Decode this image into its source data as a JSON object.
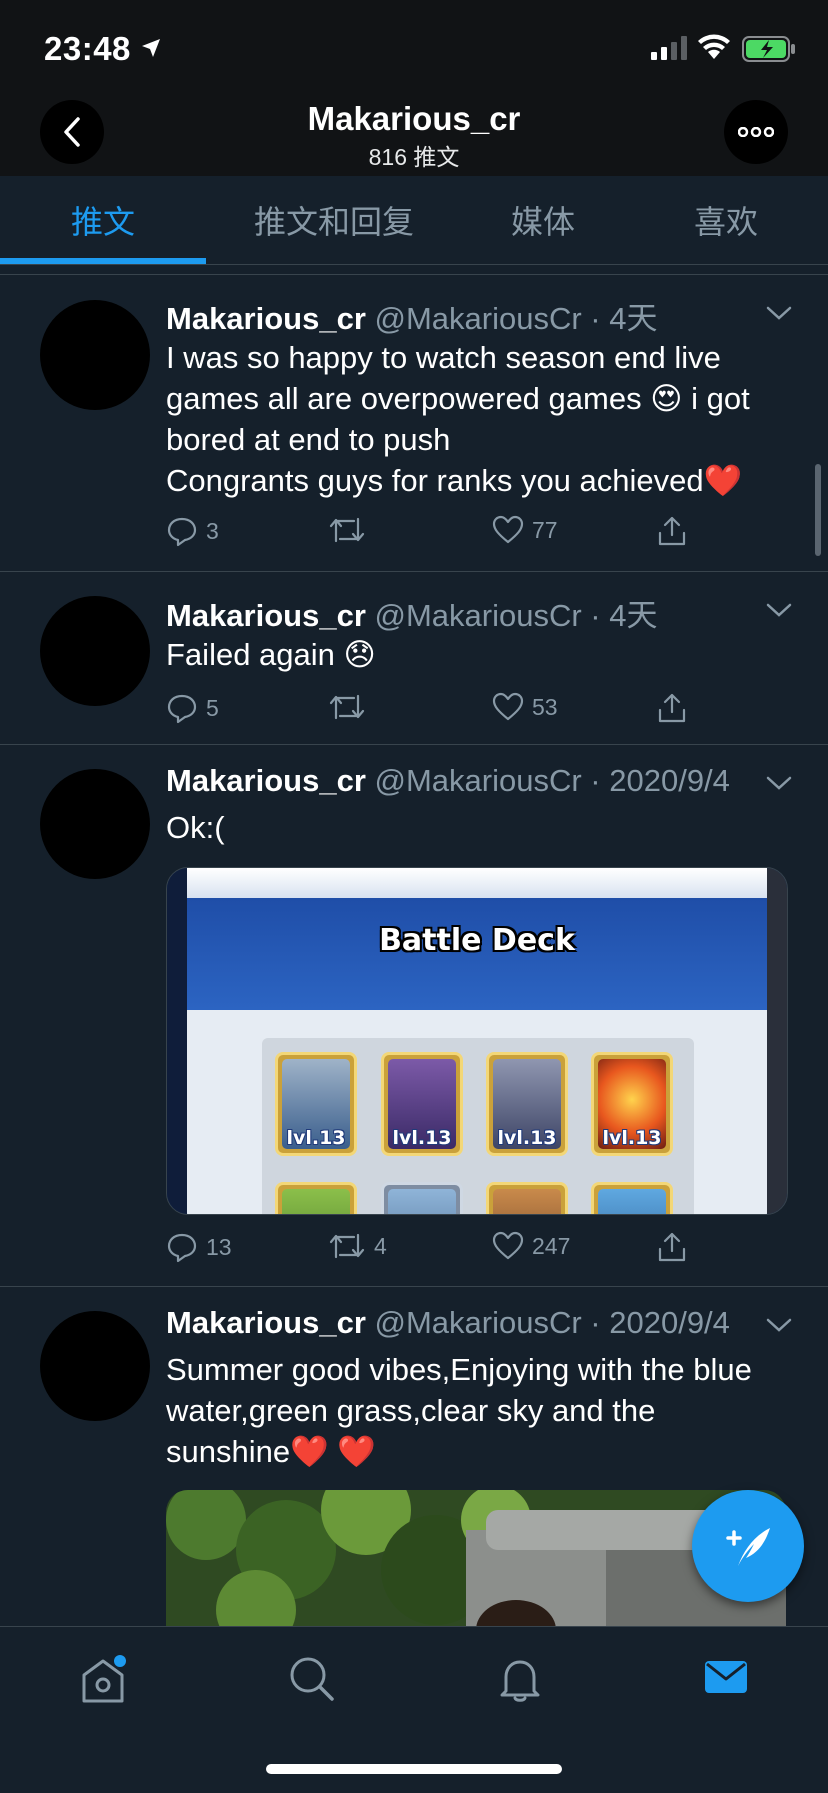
{
  "status_bar": {
    "time": "23:48",
    "icons": [
      "location-arrow-icon",
      "cellular-signal-icon",
      "wifi-icon",
      "battery-charging-icon"
    ]
  },
  "header": {
    "title": "Makarious_cr",
    "subtitle": "816 推文",
    "back_icon": "chevron-left-icon",
    "more_icon": "more-dots-icon"
  },
  "tabs": [
    {
      "label": "推文",
      "active": true
    },
    {
      "label": "推文和回复",
      "active": false
    },
    {
      "label": "媒体",
      "active": false
    },
    {
      "label": "喜欢",
      "active": false
    }
  ],
  "tweets": [
    {
      "name": "Makarious_cr",
      "meta": "@MakariousCr · 4天",
      "lines": [
        "I was so happy to watch season end live",
        "games all are overpowered games 😍 i got",
        "bored at end to push",
        "Congrants guys for ranks you achieved❤️"
      ],
      "replies": "3",
      "retweets": "",
      "likes": "77"
    },
    {
      "name": "Makarious_cr",
      "meta": "@MakariousCr · 4天",
      "lines": [
        "Failed again 😞"
      ],
      "replies": "5",
      "retweets": "",
      "likes": "53"
    },
    {
      "name": "Makarious_cr",
      "meta": "@MakariousCr · 2020/9/4",
      "lines": [
        "Ok:("
      ],
      "media": {
        "title": "Battle Deck",
        "card_levels": [
          "lvl.13",
          "lvl.13",
          "lvl.13",
          "lvl.13"
        ]
      },
      "replies": "13",
      "retweets": "4",
      "likes": "247"
    },
    {
      "name": "Makarious_cr",
      "meta": "@MakariousCr · 2020/9/4",
      "lines": [
        "Summer good vibes,Enjoying with the blue",
        "water,green grass,clear sky and the",
        "sunshine❤️ ❤️"
      ]
    }
  ],
  "fab": {
    "icon": "compose-tweet-icon"
  },
  "bottom_nav": [
    {
      "icon": "home-icon",
      "has_dot": true
    },
    {
      "icon": "search-icon"
    },
    {
      "icon": "notifications-bell-icon"
    },
    {
      "icon": "messages-mail-icon",
      "active": true
    }
  ],
  "colors": {
    "background": "#15202b",
    "accent": "#1d9bf0",
    "muted_text": "#8899a6",
    "divider": "#38444d"
  }
}
